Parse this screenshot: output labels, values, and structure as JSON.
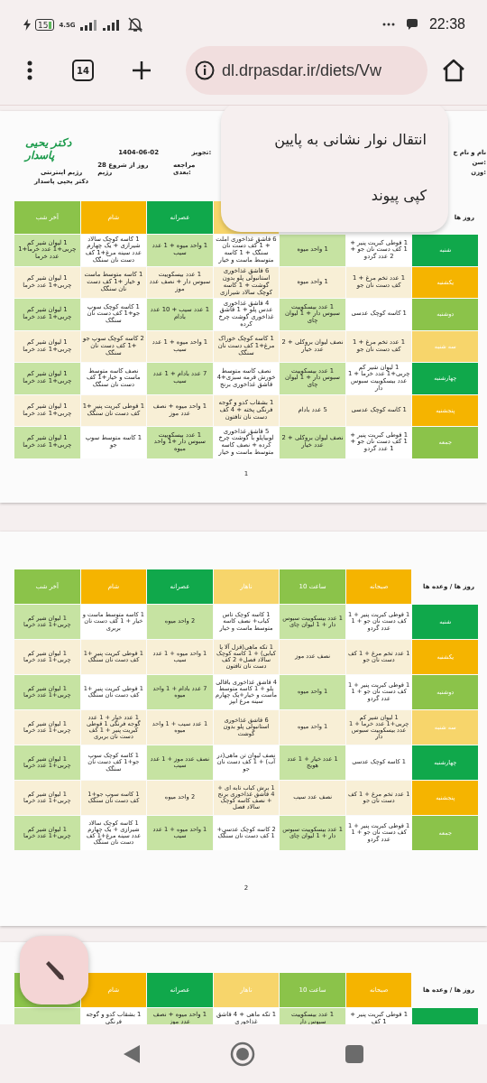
{
  "status_bar": {
    "battery": "15",
    "network": "4.5G",
    "time": "22:38"
  },
  "browser": {
    "tab_count": "14",
    "url": "dl.drpasdar.ir/diets/Vw"
  },
  "context_menu": {
    "items": [
      "انتقال نوار نشانی به پایین",
      "کپی پیوند"
    ]
  },
  "pages": [
    {
      "header": {
        "logo": "دکتر یحیی پاسدار",
        "subtitle": "رژیم اینترنتی",
        "doctor": "دکتر یحیی پاسدار",
        "date": "1404-06-02",
        "days": "28 روز از شروع رژیم",
        "prescription_label": "تجویز:",
        "next_visit_label": "مراجعه بعدی:",
        "name_label": "نام و نام خ",
        "age_label": "سن:",
        "weight_label": "وزن:"
      },
      "table": {
        "columns": [
          {
            "label": "روز ها"
          },
          {},
          {},
          {
            "color": "#f7d56b"
          },
          {
            "label": "عصرانه",
            "color": "#10a84b"
          },
          {
            "label": "شام",
            "color": "#f5b400"
          },
          {
            "label": "آخر شب",
            "color": "#8bc34a"
          }
        ],
        "rows": [
          {
            "color": "#10a84b",
            "cells": [
              "شنبه",
              "1 قوطی کبریت پنیر + 1 کف دست نان جو + 2 عدد گردو",
              "1 واحد میوه",
              "6 قاشق غذاخوری املت + 1 کف دست نان سنگک + 1 کاسه متوسط ماست و خیار",
              "1 واحد میوه + 1 عدد سیب",
              "1 کاسه کوچک سالاد شیرازی + یک چهارم عدد سینه مرغ+1 کف دست نان سنگک",
              "1 لیوان شیر کم چربی+1 عدد خرما+1 عدد خرما"
            ]
          },
          {
            "color": "#f5b400",
            "cells": [
              "یکشنبه",
              "1 عدد تخم مرغ + 1 کف دست نان جو",
              "1 واحد میوه",
              "6 قاشق غذاخوری استانبولی پلو بدون گوشت + 1 کاسه کوچک سالاد شیرازی",
              "1 عدد بیسکوییت سبوس دار + نصف عدد موز",
              "1 کاسه متوسط ماست و خیار +1 کف دست نان سنگک",
              "1 لیوان شیر کم چربی+1 عدد خرما"
            ]
          },
          {
            "color": "#8bc34a",
            "cells": [
              "دوشنبه",
              "1 کاسه کوچک عدسی",
              "1 عدد بیسکوییت سبوس دار + 1 لیوان چای",
              "4 قاشق غذاخوری عدس پلو + 1 قاشق غذاخوری گوشت چرخ کرده",
              "1 عدد سیب + 10 عدد بادام",
              "1 کاسه کوچک سوپ جو+1 کف دست نان سنگک",
              "1 لیوان شیر کم چربی+1 عدد خرما"
            ]
          },
          {
            "color": "#f7d56b",
            "cells": [
              "سه شنبه",
              "1 عدد تخم مرغ + 1 کف دست نان جو",
              "نصف لیوان بروکلی + 2 عدد خیار",
              "1 کاسه کوچک خوراک مرغ+1 کف دست نان سنگک",
              "1 واحد میوه + 1 عدد سیب",
              "2 کاسه کوچک سوپ جو +1 کف دست نان سنگک",
              "1 لیوان شیر کم چربی+1 عدد خرما"
            ]
          },
          {
            "color": "#10a84b",
            "cells": [
              "چهارشنبه",
              "1 لیوان شیر کم چربی+1 عدد خرما + 1 عدد بیسکوییت سبوس دار",
              "1 عدد بیسکوییت سبوس دار + 1 لیوان چای",
              "نصف کاسه متوسط خورش قرمه سبزی+4 قاشق غذاخوری برنج",
              "7 عدد بادام + 1 عدد سیب",
              "نصف کاسه متوسط ماست و خیار+1 کف دست نان سنگک",
              "1 لیوان شیر کم چربی+1 عدد خرما"
            ]
          },
          {
            "color": "#f5b400",
            "cells": [
              "پنجشنبه",
              "1 کاسه کوچک عدسی",
              "5 عدد بادام",
              "1 بشقاب کدو و گوجه فرنگی پخته + 4 کف دست نان تافتون",
              "1 واحد میوه + نصف عدد موز",
              "1 قوطی کبریت پنیر +1 کف دست نان سنگک",
              "1 لیوان شیر کم چربی+1 عدد خرما"
            ]
          },
          {
            "color": "#8bc34a",
            "cells": [
              "جمعه",
              "1 قوطی کبریت پنیر + 1 کف دست نان جو + 1 عدد گردو",
              "نصف لیوان بروکلی + 2 عدد خیار",
              "5 قاشق غذاخوری لوبیاپلو با گوشت چرخ کرده + نصف کاسه متوسط ماست و خیار",
              "1 عدد بیسکوییت سبوس دار +1 واحد میوه",
              "1 کاسه متوسط سوپ جو",
              "1 لیوان شیر کم چربی+1 عدد خرما"
            ]
          }
        ]
      },
      "page_number": "1"
    },
    {
      "table": {
        "columns": [
          {
            "label": "روز ها / وعده ها"
          },
          {
            "label": "صبحانه",
            "color": "#f5b400"
          },
          {
            "label": "ساعت 10",
            "color": "#8bc34a"
          },
          {
            "label": "ناهار",
            "color": "#f7d56b"
          },
          {
            "label": "عصرانه",
            "color": "#10a84b"
          },
          {
            "label": "شام",
            "color": "#f5b400"
          },
          {
            "label": "آخر شب",
            "color": "#8bc34a"
          }
        ],
        "rows": [
          {
            "color": "#10a84b",
            "cells": [
              "شنبه",
              "1 قوطی کبریت پنیر + 1 کف دست نان جو + 1 عدد گردو",
              "1 عدد بیسکوییت سبوس دار + 1 لیوان چای",
              "1 کاسه کوچک تاس کباب+ نصف کاسه متوسط ماست و خیار",
              "2 واحد میوه",
              "1 کاسه متوسط ماست و خیار + 1 کف دست نان بربری",
              "1 لیوان شیر کم چربی+1 عدد خرما"
            ]
          },
          {
            "color": "#f5b400",
            "cells": [
              "یکشنبه",
              "1 عدد تخم مرغ + 1 کف دست نان جو",
              "نصف عدد موز",
              "1 تکه ماهی(قزل آلا یا کبابی) + 1 کاسه کوچک سالاد فصل+ 2 کف دست نان تافتون",
              "1 واحد میوه + 1 عدد سیب",
              "1 قوطی کبریت پنیر +1 کف دست نان سنگک",
              "1 لیوان شیر کم چربی+1 عدد خرما"
            ]
          },
          {
            "color": "#8bc34a",
            "cells": [
              "دوشنبه",
              "1 قوطی کبریت پنیر + 1 کف دست نان جو + 1 عدد گردو",
              "1 واحد میوه",
              "4 قاشق غذاخوری باقالی پلو + 1 کاسه متوسط ماست و خیار+یک چهارم سینه مرغ ابپز",
              "7 عدد بادام + 1 واحد میوه",
              "1 قوطی کبریت پنیر +1 کف دست نان سنگک",
              "1 لیوان شیر کم چربی+1 عدد خرما"
            ]
          },
          {
            "color": "#f7d56b",
            "cells": [
              "سه شنبه",
              "1 لیوان شیر کم چربی+1 عدد خرما + 1 عدد بیسکوییت سبوس دار",
              "1 واحد میوه",
              "6 قاشق غذاخوری استانبولی پلو بدون گوشت",
              "1 عدد سیب + 1 واحد میوه",
              "1 عدد خیار + 1 عدد گوجه فرنگی 1 قوطی کبریت پنیر + 1 کف دست نان بربری",
              "1 لیوان شیر کم چربی+1 عدد خرما"
            ]
          },
          {
            "color": "#10a84b",
            "cells": [
              "چهارشنبه",
              "1 کاسه کوچک عدسی",
              "1 عدد خیار + 1 عدد هویج",
              "نصف لیوان تن ماهی(در آب) + 1 کف دست نان جو",
              "نصف عدد موز + 1 عدد سیب",
              "1 کاسه کوچک سوپ جو+1 کف دست نان سنگک",
              "1 لیوان شیر کم چربی+1 عدد خرما"
            ]
          },
          {
            "color": "#f5b400",
            "cells": [
              "پنجشنبه",
              "1 عدد تخم مرغ + 1 کف دست نان جو",
              "نصف عدد سیب",
              "1 برش کباب تابه ای + 4 قاشق غذاخوری برنج + نصف کاسه کوچک سالاد فصل",
              "2 واحد میوه",
              "1 کاسه سوپ جو+1 کف دست نان سنگک",
              "1 لیوان شیر کم چربی+1 عدد خرما"
            ]
          },
          {
            "color": "#8bc34a",
            "cells": [
              "جمعه",
              "1 قوطی کبریت پنیر + 1 کف دست نان جو + 1 عدد گردو",
              "1 عدد بیسکوییت سبوس دار + 1 لیوان چای",
              "2 کاسه کوچک عدسی+ 1 کف دست نان سنگک",
              "1 واحد میوه + 1 عدد سیب",
              "1 کاسه کوچک سالاد شیرازی + یک چهارم عدد سینه مرغ+1 کف دست نان سنگک",
              "1 لیوان شیر کم چربی+1 عدد خرما"
            ]
          }
        ]
      },
      "page_number": "2"
    },
    {
      "table": {
        "columns": [
          {
            "label": "روز ها / وعده ها"
          },
          {
            "label": "صبحانه",
            "color": "#f5b400"
          },
          {
            "label": "ساعت 10",
            "color": "#8bc34a"
          },
          {
            "label": "ناهار",
            "color": "#f7d56b"
          },
          {
            "label": "عصرانه",
            "color": "#10a84b"
          },
          {
            "label": "شام",
            "color": "#f5b400"
          },
          {
            "color": "#8bc34a"
          }
        ],
        "rows": [
          {
            "color": "#10a84b",
            "cells": [
              "",
              "1 قوطی کبریت پنیر + 1 کف",
              "1 عدد بیسکوییت سبوس دار",
              "1 تکه ماهی + 4 قاشق غذاخوری",
              "1 واحد میوه + نصف عدد موز",
              "1 بشقاب کدو و گوجه فرنگی",
              ""
            ]
          }
        ]
      }
    }
  ]
}
